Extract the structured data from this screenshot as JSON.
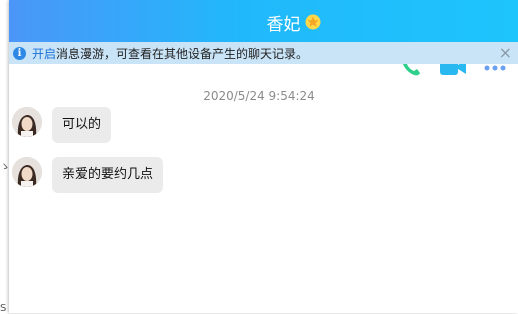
{
  "background": {
    "fragment_top": "ゝ",
    "fragment_bottom": "S"
  },
  "header": {
    "title": "香妃",
    "colors": {
      "gradient_start": "#4b96f8",
      "gradient_end": "#1ec4fc"
    },
    "icons": [
      "star-badge-icon",
      "phone-call-icon",
      "video-call-icon",
      "more-icon"
    ]
  },
  "notice": {
    "link": "开启",
    "text": "消息漫游，可查看在其他设备产生的聊天记录。",
    "close": "×"
  },
  "chat": {
    "timestamp": "2020/5/24 9:54:24",
    "messages": [
      {
        "text": "可以的"
      },
      {
        "text": "亲爱的要约几点"
      }
    ]
  }
}
